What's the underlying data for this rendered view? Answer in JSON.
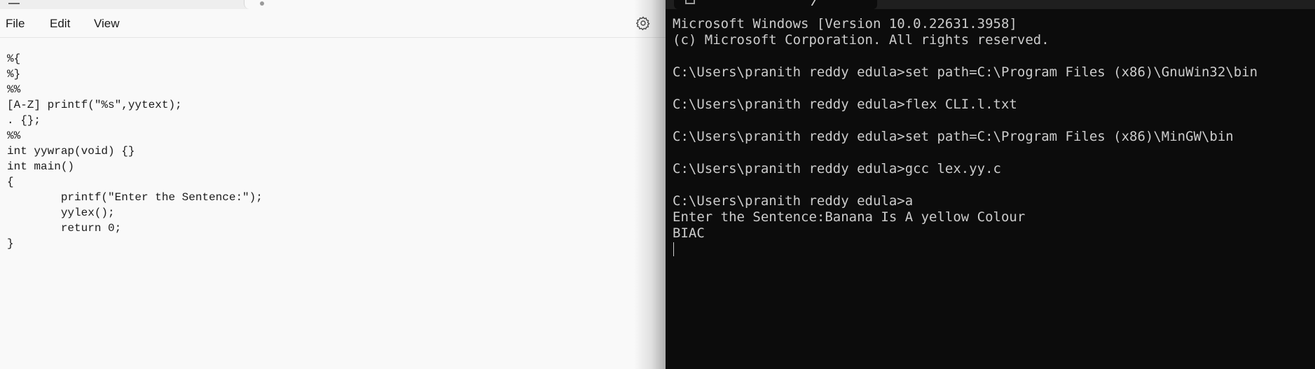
{
  "notepad": {
    "menu": {
      "file": "File",
      "edit": "Edit",
      "view": "View"
    },
    "settings_icon": "gear-icon",
    "lines": [
      "%{",
      "%}",
      "%%",
      "[A-Z] printf(\"%s\",yytext);",
      ". {};",
      "%%",
      "int yywrap(void) {}",
      "int main()",
      "{",
      "        printf(\"Enter the Sentence:\");",
      "        yylex();",
      "        return 0;",
      "}"
    ]
  },
  "terminal": {
    "lines": [
      "Microsoft Windows [Version 10.0.22631.3958]",
      "(c) Microsoft Corporation. All rights reserved.",
      "",
      "C:\\Users\\pranith reddy edula>set path=C:\\Program Files (x86)\\GnuWin32\\bin",
      "",
      "C:\\Users\\pranith reddy edula>flex CLI.l.txt",
      "",
      "C:\\Users\\pranith reddy edula>set path=C:\\Program Files (x86)\\MinGW\\bin",
      "",
      "C:\\Users\\pranith reddy edula>gcc lex.yy.c",
      "",
      "C:\\Users\\pranith reddy edula>a",
      "Enter the Sentence:Banana Is A yellow Colour",
      "BIAC"
    ]
  },
  "colors": {
    "notepad_bg": "#f9f9f9",
    "terminal_bg": "#0c0c0c",
    "terminal_text": "#cccccc"
  }
}
